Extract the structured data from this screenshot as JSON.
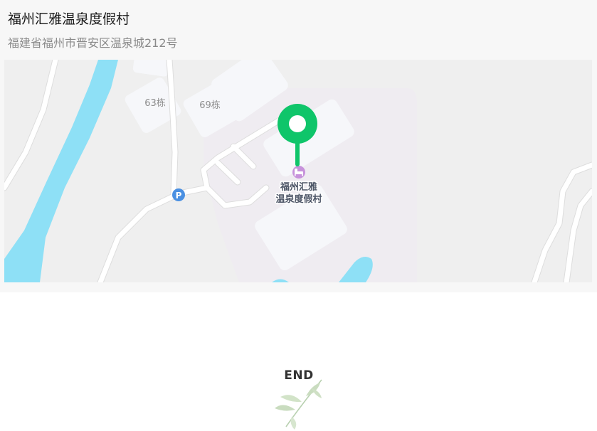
{
  "location": {
    "name": "福州汇雅温泉度假村",
    "address": "福建省福州市晋安区温泉城212号"
  },
  "map": {
    "building_labels": [
      "63栋",
      "69栋"
    ],
    "poi_label_line1": "福州汇雅",
    "poi_label_line2": "温泉度假村",
    "parking_label": "P",
    "pin_icon": "map-pin-icon",
    "hotel_icon": "hotel-bed-icon",
    "colors": {
      "land": "#efefef",
      "resort_area": "#efecf1",
      "building": "#f6f7fa",
      "road": "#ffffff",
      "water": "#8ee0f6",
      "pin": "#0fc56a",
      "hotel": "#c792db",
      "parking": "#4a90e2"
    }
  },
  "footer": {
    "end_text": "END",
    "decoration_icon": "leaf-sprig-icon"
  }
}
